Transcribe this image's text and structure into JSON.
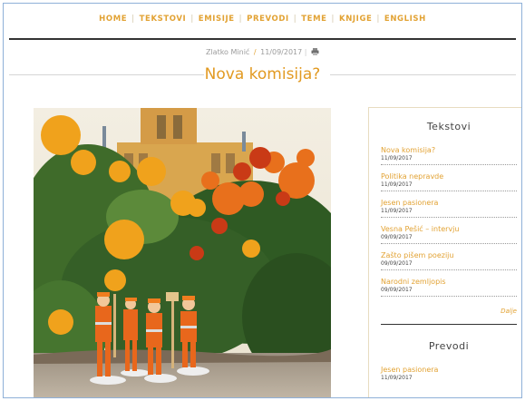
{
  "nav": {
    "items": [
      "HOME",
      "TEKSTOVI",
      "EMISIJE",
      "PREVODI",
      "TEME",
      "KNJIGE",
      "ENGLISH"
    ],
    "separator": "|"
  },
  "article": {
    "author": "Zlatko Minić",
    "slash": "/",
    "date": "11/09/2017",
    "title": "Nova komisija?"
  },
  "sidebar": {
    "tekstovi_heading": "Tekstovi",
    "tekstovi": [
      {
        "title": "Nova komisija?",
        "date": "11/09/2017"
      },
      {
        "title": "Politika nepravde",
        "date": "11/09/2017"
      },
      {
        "title": "Jesen pasionera",
        "date": "11/09/2017"
      },
      {
        "title": "Vesna Pešić – intervju",
        "date": "09/09/2017"
      },
      {
        "title": "Zašto pišem poeziju",
        "date": "09/09/2017"
      },
      {
        "title": "Narodni zemljopis",
        "date": "09/09/2017"
      }
    ],
    "more_label": "Dalje",
    "prevodi_heading": "Prevodi",
    "prevodi": [
      {
        "title": "Jesen pasionera",
        "date": "11/09/2017"
      }
    ]
  },
  "colors": {
    "accent": "#e2a233",
    "frame": "#8fb0d8",
    "text": "#444444"
  },
  "icons": {
    "print": "printer-icon"
  }
}
